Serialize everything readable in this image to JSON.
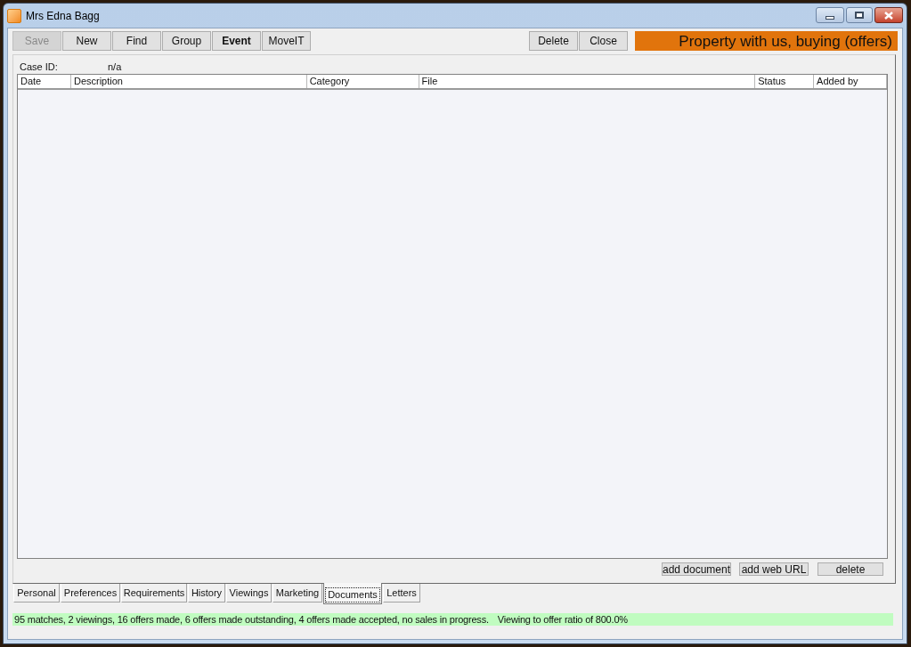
{
  "window": {
    "title": "Mrs Edna Bagg"
  },
  "toolbar": {
    "left_buttons": [
      {
        "label": "Save",
        "disabled": true,
        "bold": false
      },
      {
        "label": "New",
        "disabled": false,
        "bold": false
      },
      {
        "label": "Find",
        "disabled": false,
        "bold": false
      },
      {
        "label": "Group",
        "disabled": false,
        "bold": false
      },
      {
        "label": "Event",
        "disabled": false,
        "bold": true
      },
      {
        "label": "MoveIT",
        "disabled": false,
        "bold": false
      }
    ],
    "right_buttons": [
      "Delete",
      "Close"
    ],
    "status_banner": "Property with us, buying (offers)"
  },
  "case": {
    "label": "Case ID:",
    "value": "n/a"
  },
  "documents_table": {
    "columns": [
      "Date",
      "Description",
      "Category",
      "File",
      "Status",
      "Added by"
    ]
  },
  "document_actions": [
    "add document",
    "add web URL",
    "delete"
  ],
  "tabs": [
    {
      "label": "Personal",
      "selected": false
    },
    {
      "label": "Preferences",
      "selected": false
    },
    {
      "label": "Requirements",
      "selected": false
    },
    {
      "label": "History",
      "selected": false
    },
    {
      "label": "Viewings",
      "selected": false
    },
    {
      "label": "Marketing",
      "selected": false
    },
    {
      "label": "Documents",
      "selected": true
    },
    {
      "label": "Letters",
      "selected": false
    }
  ],
  "status_bar": {
    "summary": "95 matches, 2 viewings, 16 offers made, 6 offers made outstanding, 4 offers made accepted, no sales in progress.",
    "ratio": "Viewing to offer ratio of 800.0%"
  }
}
